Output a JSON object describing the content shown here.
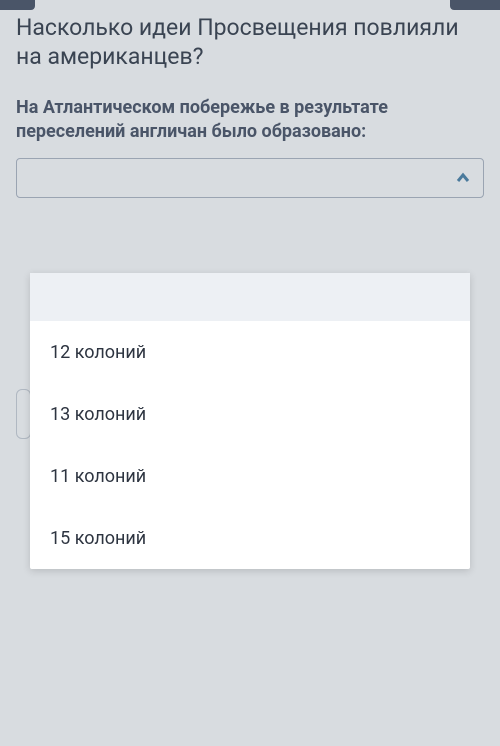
{
  "page_title": "Насколько идеи Просвещения повлияли на американцев?",
  "question": "На Атлантическом побережье в результате переселений англичан было образовано:",
  "select": {
    "value": ""
  },
  "dropdown": {
    "options": [
      "12 колоний",
      "13 колоний",
      "11 колоний",
      "15 колоний"
    ]
  }
}
